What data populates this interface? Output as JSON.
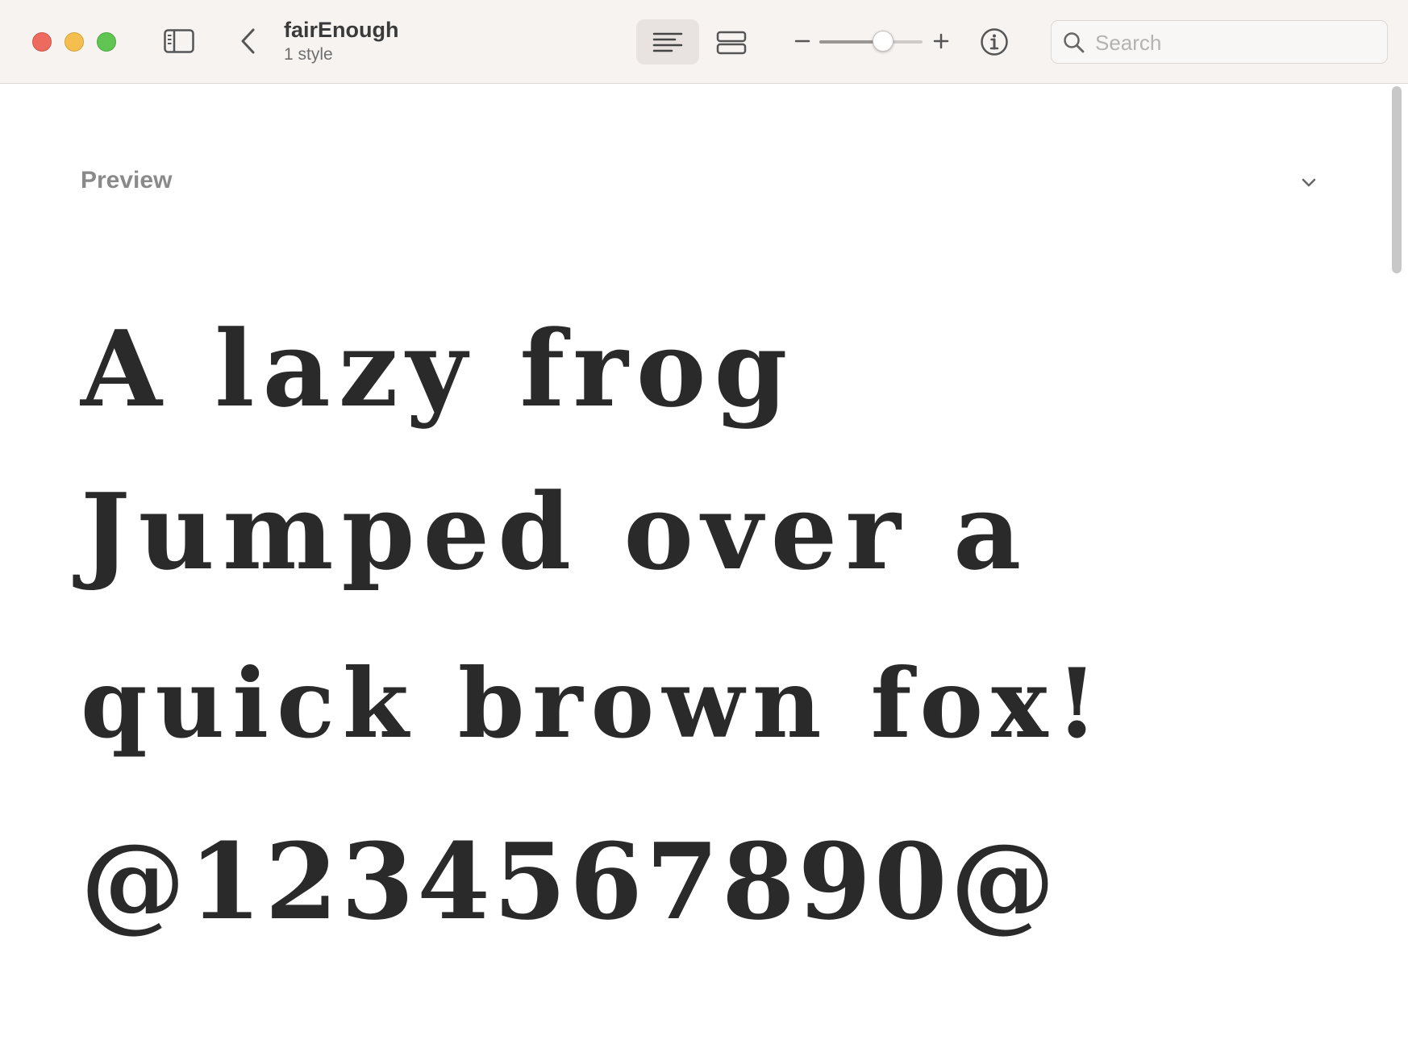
{
  "window": {
    "title": "fairEnough",
    "subtitle": "1 style",
    "controls": [
      "close-icon",
      "minimize-icon",
      "zoom-icon"
    ]
  },
  "toolbar": {
    "sidebar_icon": "sidebar-toggle-icon",
    "back_icon": "chevron-left-icon",
    "view_modes": [
      "list-view-icon",
      "grid-view-icon"
    ],
    "selected_view": "list-view-icon",
    "zoom_level": 0.62,
    "info_icon": "info-circle-icon"
  },
  "search": {
    "placeholder": "Search",
    "value": ""
  },
  "preview": {
    "section_title": "Preview",
    "lines": [
      "A lazy frog",
      "Jumped over a",
      "quick brown fox!",
      "@1234567890@"
    ]
  },
  "colors": {
    "titlebar_bg": "#f7f3f1",
    "glyph": "#2a2a2a",
    "close": "#ec6a5e",
    "minimize": "#f4bf4f",
    "zoom": "#61c554"
  }
}
